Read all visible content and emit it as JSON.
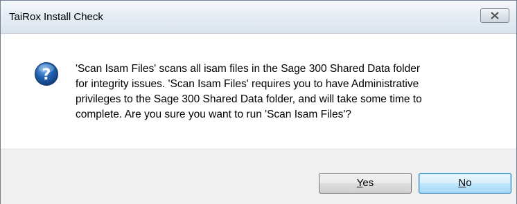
{
  "window": {
    "title": "TaiRox Install Check"
  },
  "dialog": {
    "icon": "question-icon",
    "message_lines": [
      "'Scan Isam Files' scans all isam files in the Sage 300 Shared Data folder",
      "for integrity issues. 'Scan Isam Files' requires you to have Administrative",
      "privileges to the Sage 300 Shared Data folder, and will take some time to",
      "complete. Are you sure you want to run 'Scan Isam Files'?"
    ]
  },
  "buttons": {
    "yes": {
      "mnemonic": "Y",
      "rest": "es"
    },
    "no": {
      "mnemonic": "N",
      "rest": "o"
    }
  },
  "colors": {
    "icon_blue": "#1f5fae",
    "default_button_border": "#3c7fb1"
  }
}
